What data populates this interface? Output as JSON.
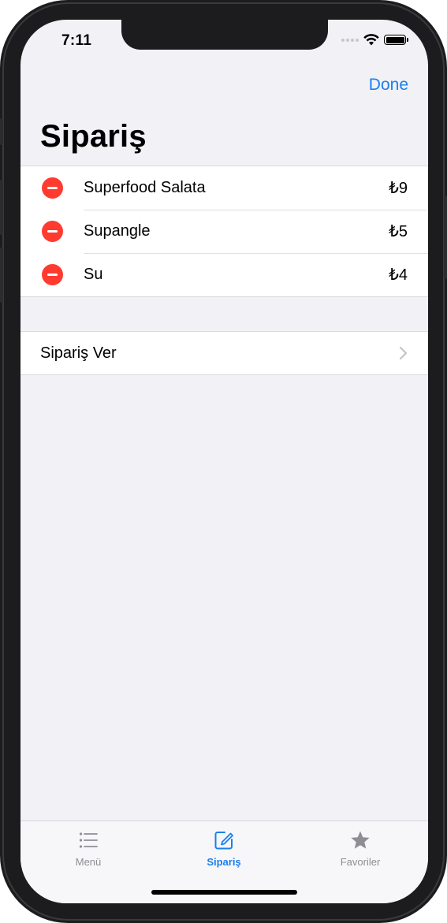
{
  "status_bar": {
    "time": "7:11"
  },
  "nav": {
    "done_label": "Done",
    "title": "Sipariş"
  },
  "order_items": [
    {
      "name": "Superfood Salata",
      "price": "₺9"
    },
    {
      "name": "Supangle",
      "price": "₺5"
    },
    {
      "name": "Su",
      "price": "₺4"
    }
  ],
  "action": {
    "label": "Sipariş Ver"
  },
  "tabs": [
    {
      "label": "Menü",
      "icon": "list-icon",
      "active": false
    },
    {
      "label": "Sipariş",
      "icon": "compose-icon",
      "active": true
    },
    {
      "label": "Favoriler",
      "icon": "star-icon",
      "active": false
    }
  ],
  "colors": {
    "accent": "#1a7ff0",
    "delete": "#ff3b30",
    "background": "#f1f1f6"
  }
}
